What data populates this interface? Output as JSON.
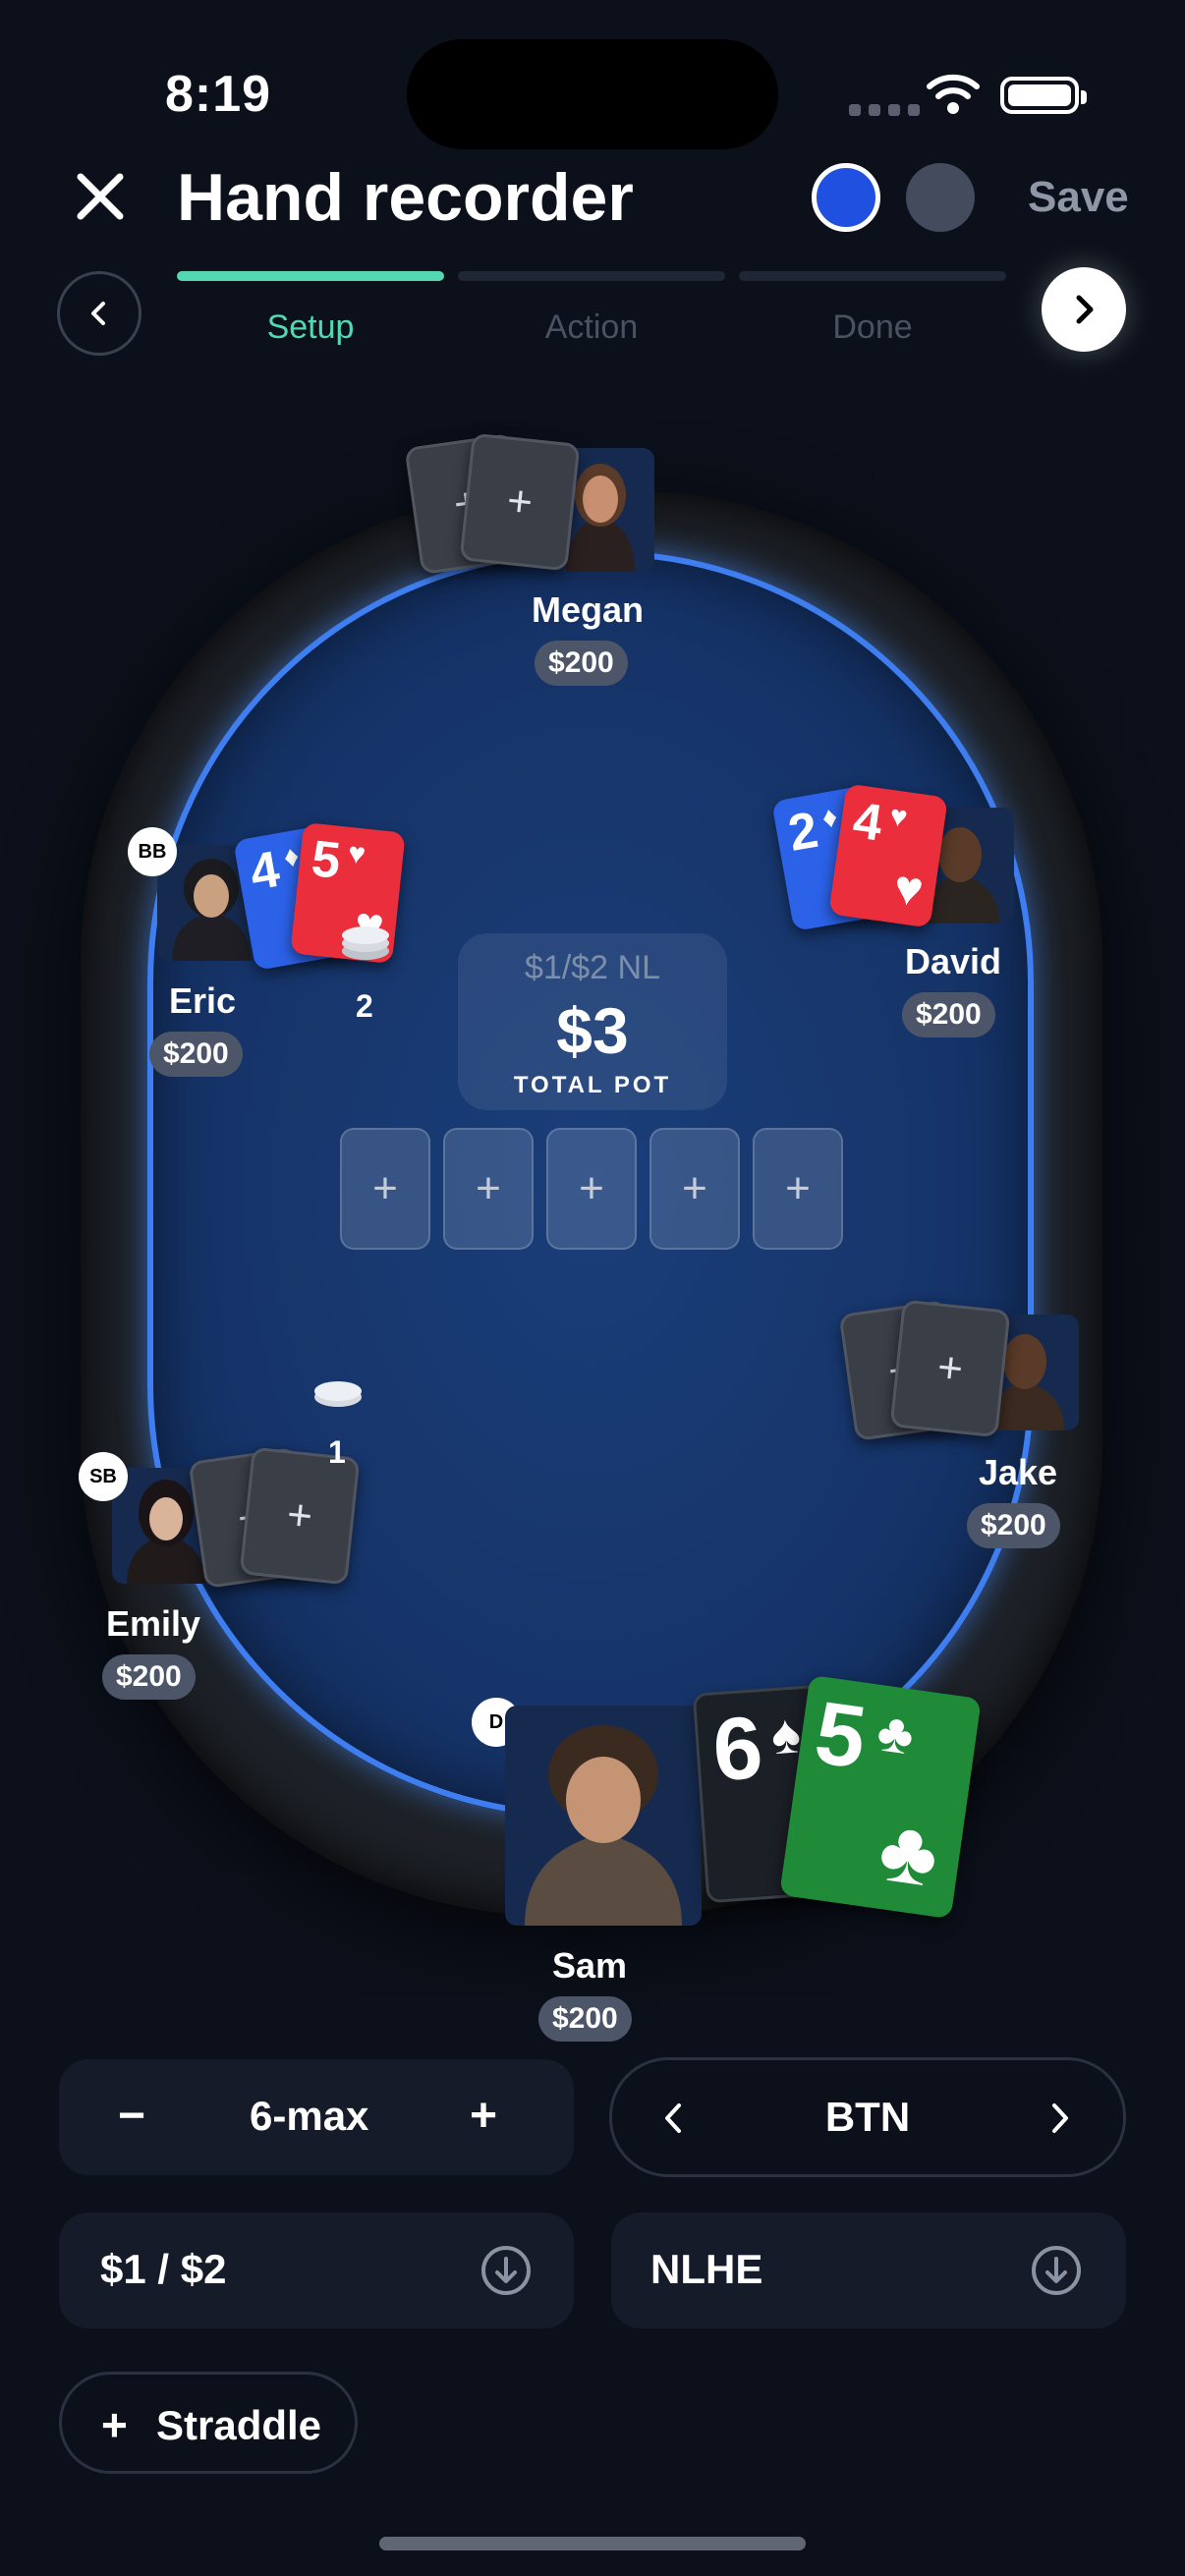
{
  "status_bar": {
    "time": "8:19"
  },
  "header": {
    "title": "Hand recorder",
    "save_label": "Save",
    "colors": [
      "#2050e0",
      "#434b5c"
    ]
  },
  "steps": [
    {
      "label": "Setup",
      "active": true
    },
    {
      "label": "Action",
      "active": false
    },
    {
      "label": "Done",
      "active": false
    }
  ],
  "pot": {
    "stakes": "$1/$2 NL",
    "amount": "$3",
    "label": "TOTAL POT"
  },
  "board": {
    "slots": [
      "+",
      "+",
      "+",
      "+",
      "+"
    ]
  },
  "players": {
    "megan": {
      "name": "Megan",
      "stack": "$200",
      "cards": [
        "+",
        "+"
      ]
    },
    "eric": {
      "name": "Eric",
      "stack": "$200",
      "badge": "BB",
      "bet": "2",
      "cards": [
        {
          "rank": "4",
          "suit": "♦"
        },
        {
          "rank": "5",
          "suit": "♥"
        }
      ]
    },
    "david": {
      "name": "David",
      "stack": "$200",
      "cards": [
        {
          "rank": "2",
          "suit": "♦"
        },
        {
          "rank": "4",
          "suit": "♥"
        }
      ]
    },
    "jake": {
      "name": "Jake",
      "stack": "$200",
      "cards": [
        "+",
        "+"
      ]
    },
    "emily": {
      "name": "Emily",
      "stack": "$200",
      "badge": "SB",
      "bet": "1",
      "cards": [
        "+",
        "+"
      ]
    },
    "sam": {
      "name": "Sam",
      "stack": "$200",
      "badge": "D",
      "cards": [
        {
          "rank": "6",
          "suit": "♠"
        },
        {
          "rank": "5",
          "suit": "♣"
        }
      ]
    }
  },
  "controls": {
    "table_size": {
      "value": "6-max",
      "minus": "−",
      "plus": "+"
    },
    "position": {
      "value": "BTN"
    },
    "stakes": {
      "value": "$1 / $2"
    },
    "game": {
      "value": "NLHE"
    },
    "straddle": {
      "label": "Straddle",
      "icon": "+"
    }
  }
}
